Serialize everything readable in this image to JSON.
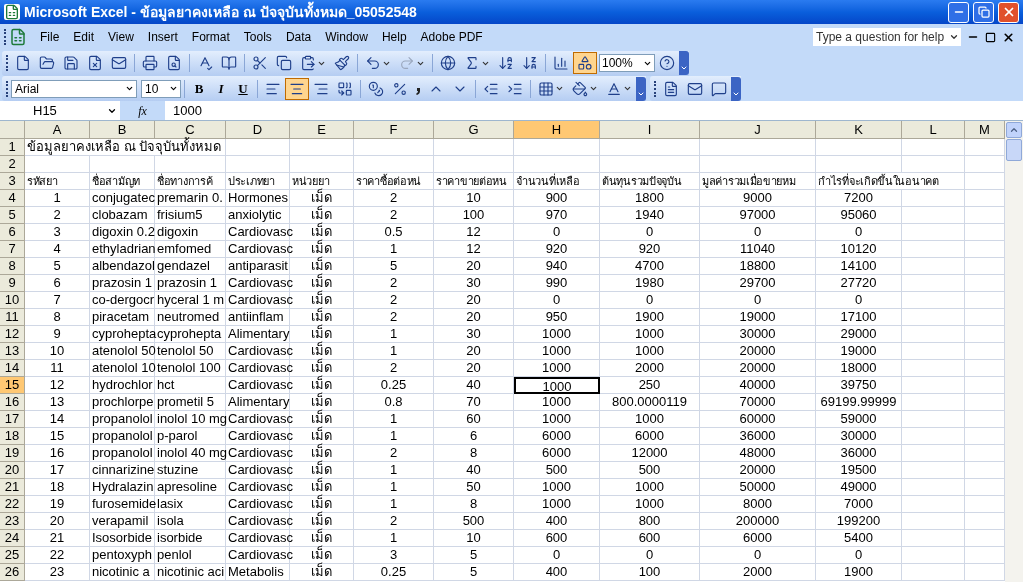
{
  "window": {
    "title": "Microsoft Excel - ข้อมูลยาคงเหลือ ณ ปัจจุบันทั้งหมด_05052548"
  },
  "menu": [
    "File",
    "Edit",
    "View",
    "Insert",
    "Format",
    "Tools",
    "Data",
    "Window",
    "Help",
    "Adobe PDF"
  ],
  "help_box": {
    "placeholder": "Type a question for help"
  },
  "standard_toolbar": {
    "zoom": "100%",
    "drawing_pressed": true,
    "redo_disabled": true
  },
  "formatting_toolbar": {
    "font": "Arial",
    "size": "10",
    "bold": "B",
    "italic": "I",
    "underline": "U",
    "alignments": [
      {
        "selected": false
      },
      {
        "selected": true
      },
      {
        "selected": false
      }
    ]
  },
  "formula_bar": {
    "name_box": "H15",
    "function_label": "fx",
    "value": "1000"
  },
  "columns": [
    {
      "label": "A",
      "selected": false
    },
    {
      "label": "B",
      "selected": false
    },
    {
      "label": "C",
      "selected": false
    },
    {
      "label": "D",
      "selected": false
    },
    {
      "label": "E",
      "selected": false
    },
    {
      "label": "F",
      "selected": false
    },
    {
      "label": "G",
      "selected": false
    },
    {
      "label": "H",
      "selected": true
    },
    {
      "label": "I",
      "selected": false
    },
    {
      "label": "J",
      "selected": false
    },
    {
      "label": "K",
      "selected": false
    },
    {
      "label": "L",
      "selected": false
    },
    {
      "label": "M",
      "selected": false
    }
  ],
  "rows": [
    {
      "number": "1",
      "selected": false,
      "kind": "title",
      "cells": [
        "ข้อมูลยาคงเหลือ ณ ปัจจุบันทั้งหมด"
      ]
    },
    {
      "number": "2",
      "selected": false,
      "kind": "blank",
      "cells": []
    },
    {
      "number": "3",
      "selected": false,
      "kind": "header",
      "cells": [
        "รหัสยา",
        "ชื่อสามัญท",
        "ชื่อทางการค้",
        "ประเภทยา",
        "หน่วยยา",
        "ราคาซื้อต่อหน่",
        "ราคาขายต่อหน",
        "จำนวนที่เหลือ",
        "ต้นทุนรวมปัจจุบัน",
        "มูลค่ารวมเมื่อขายหม",
        "กำไรที่จะเกิดขึ้นในอนาคต"
      ]
    },
    {
      "number": "4",
      "selected": false,
      "kind": "data",
      "cells": [
        "1",
        "conjugatec",
        "premarin 0.",
        "Hormones",
        "เม็ด",
        "2",
        "10",
        "900",
        "1800",
        "9000",
        "7200"
      ]
    },
    {
      "number": "5",
      "selected": false,
      "kind": "data",
      "cells": [
        "2",
        "clobazam",
        "frisium5",
        "anxiolytic",
        "เม็ด",
        "2",
        "100",
        "970",
        "1940",
        "97000",
        "95060"
      ]
    },
    {
      "number": "6",
      "selected": false,
      "kind": "data",
      "cells": [
        "3",
        "digoxin 0.2",
        "digoxin",
        "Cardiovasc",
        "เม็ด",
        "0.5",
        "12",
        "0",
        "0",
        "0",
        "0"
      ]
    },
    {
      "number": "7",
      "selected": false,
      "kind": "data",
      "cells": [
        "4",
        "ethyladrian",
        "emfomed",
        "Cardiovasc",
        "เม็ด",
        "1",
        "12",
        "920",
        "920",
        "11040",
        "10120"
      ]
    },
    {
      "number": "8",
      "selected": false,
      "kind": "data",
      "cells": [
        "5",
        "albendazol",
        "gendazel",
        "antiparasit",
        "เม็ด",
        "5",
        "20",
        "940",
        "4700",
        "18800",
        "14100"
      ]
    },
    {
      "number": "9",
      "selected": false,
      "kind": "data",
      "cells": [
        "6",
        "prazosin 1",
        "prazosin 1",
        "Cardiovasc",
        "เม็ด",
        "2",
        "30",
        "990",
        "1980",
        "29700",
        "27720"
      ]
    },
    {
      "number": "10",
      "selected": false,
      "kind": "data",
      "cells": [
        "7",
        "co-dergocr",
        "hyceral 1 m",
        "Cardiovasc",
        "เม็ด",
        "2",
        "20",
        "0",
        "0",
        "0",
        "0"
      ]
    },
    {
      "number": "11",
      "selected": false,
      "kind": "data",
      "cells": [
        "8",
        "piracetam",
        "neutromed",
        "antiinflam",
        "เม็ด",
        "2",
        "20",
        "950",
        "1900",
        "19000",
        "17100"
      ]
    },
    {
      "number": "12",
      "selected": false,
      "kind": "data",
      "cells": [
        "9",
        "cyprohepta",
        "cyprohepta",
        "Alimentary",
        "เม็ด",
        "1",
        "30",
        "1000",
        "1000",
        "30000",
        "29000"
      ]
    },
    {
      "number": "13",
      "selected": false,
      "kind": "data",
      "cells": [
        "10",
        "atenolol 50",
        "tenolol 50",
        "Cardiovasc",
        "เม็ด",
        "1",
        "20",
        "1000",
        "1000",
        "20000",
        "19000"
      ]
    },
    {
      "number": "14",
      "selected": false,
      "kind": "data",
      "cells": [
        "11",
        "atenolol 10",
        "tenolol 100",
        "Cardiovasc",
        "เม็ด",
        "2",
        "20",
        "1000",
        "2000",
        "20000",
        "18000"
      ]
    },
    {
      "number": "15",
      "selected": true,
      "kind": "data",
      "cells": [
        "12",
        "hydrochlor",
        "hct",
        "Cardiovasc",
        "เม็ด",
        "0.25",
        "40",
        "1000",
        "250",
        "40000",
        "39750"
      ]
    },
    {
      "number": "16",
      "selected": false,
      "kind": "data",
      "cells": [
        "13",
        "prochlorpe",
        "prometil 5",
        "Alimentary",
        "เม็ด",
        "0.8",
        "70",
        "1000",
        "800.0000119",
        "70000",
        "69199.99999"
      ]
    },
    {
      "number": "17",
      "selected": false,
      "kind": "data",
      "cells": [
        "14",
        "propanolol",
        "inolol 10 mg",
        "Cardiovasc",
        "เม็ด",
        "1",
        "60",
        "1000",
        "1000",
        "60000",
        "59000"
      ]
    },
    {
      "number": "18",
      "selected": false,
      "kind": "data",
      "cells": [
        "15",
        "propanolol",
        "p-parol",
        "Cardiovasc",
        "เม็ด",
        "1",
        "6",
        "6000",
        "6000",
        "36000",
        "30000"
      ]
    },
    {
      "number": "19",
      "selected": false,
      "kind": "data",
      "cells": [
        "16",
        "propanolol",
        "inolol 40 mg",
        "Cardiovasc",
        "เม็ด",
        "2",
        "8",
        "6000",
        "12000",
        "48000",
        "36000"
      ]
    },
    {
      "number": "20",
      "selected": false,
      "kind": "data",
      "cells": [
        "17",
        "cinnarizine",
        "stuzine",
        "Cardiovasc",
        "เม็ด",
        "1",
        "40",
        "500",
        "500",
        "20000",
        "19500"
      ]
    },
    {
      "number": "21",
      "selected": false,
      "kind": "data",
      "cells": [
        "18",
        "Hydralazin",
        "apresoline",
        "Cardiovasc",
        "เม็ด",
        "1",
        "50",
        "1000",
        "1000",
        "50000",
        "49000"
      ]
    },
    {
      "number": "22",
      "selected": false,
      "kind": "data",
      "cells": [
        "19",
        "furosemide",
        "lasix",
        "Cardiovasc",
        "เม็ด",
        "1",
        "8",
        "1000",
        "1000",
        "8000",
        "7000"
      ]
    },
    {
      "number": "23",
      "selected": false,
      "kind": "data",
      "cells": [
        "20",
        "verapamil",
        "isola",
        "Cardiovasc",
        "เม็ด",
        "2",
        "500",
        "400",
        "800",
        "200000",
        "199200"
      ]
    },
    {
      "number": "24",
      "selected": false,
      "kind": "data",
      "cells": [
        "21",
        "Isosorbide",
        "isorbide",
        "Cardiovasc",
        "เม็ด",
        "1",
        "10",
        "600",
        "600",
        "6000",
        "5400"
      ]
    },
    {
      "number": "25",
      "selected": false,
      "kind": "data",
      "cells": [
        "22",
        "pentoxyph",
        "penlol",
        "Cardiovasc",
        "เม็ด",
        "3",
        "5",
        "0",
        "0",
        "0",
        "0"
      ]
    },
    {
      "number": "26",
      "selected": false,
      "kind": "data",
      "cells": [
        "23",
        "nicotinic a",
        "nicotinic aci",
        "Metabolis",
        "เม็ด",
        "0.25",
        "5",
        "400",
        "100",
        "2000",
        "1900"
      ]
    }
  ]
}
